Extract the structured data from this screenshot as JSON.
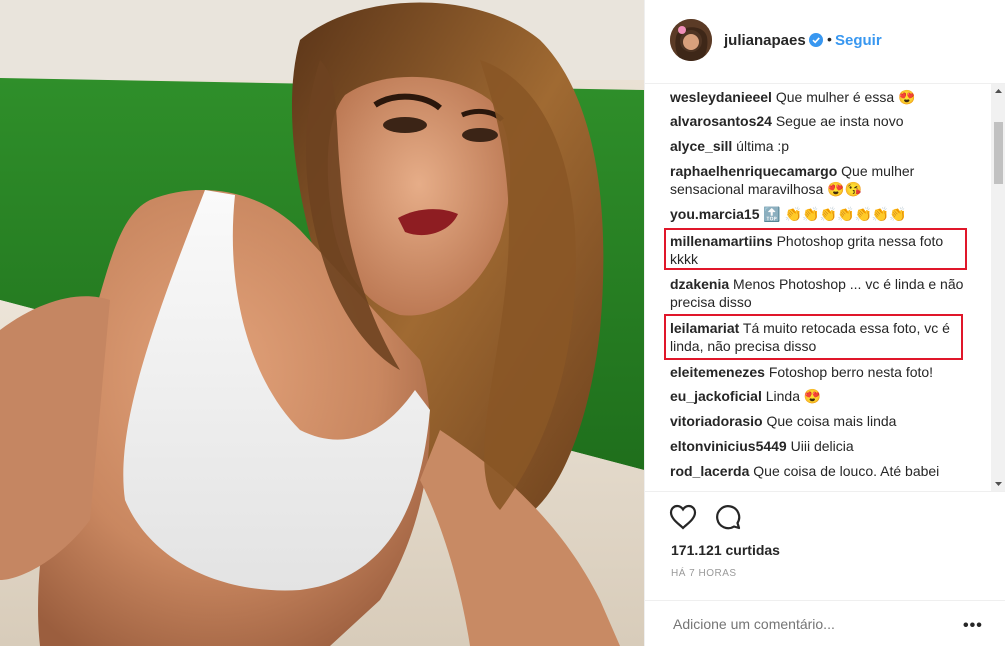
{
  "post": {
    "image_alt": "Woman in a white tank top posing on a floor with green grass behind"
  },
  "header": {
    "username": "julianapaes",
    "separator": "•",
    "follow_label": "Seguir"
  },
  "comments": [
    {
      "user": "wesleydanieeel",
      "text": "Que mulher é essa 😍"
    },
    {
      "user": "alvarosantos24",
      "text": "Segue ae insta novo"
    },
    {
      "user": "alyce_sill",
      "text": "última :p"
    },
    {
      "user": "raphaelhenriquecamargo",
      "text": "Que mulher sensacional maravilhosa 😍😘"
    },
    {
      "user": "you.marcia15",
      "text": "🔝 👏👏👏👏👏👏👏"
    },
    {
      "user": "millenamartiins",
      "text": "Photoshop grita nessa foto kkkk"
    },
    {
      "user": "dzakenia",
      "text": "Menos Photoshop ... vc é linda e não precisa disso"
    },
    {
      "user": "leilamariat",
      "text": "Tá muito retocada essa foto, vc é linda, não precisa disso"
    },
    {
      "user": "eleitemenezes",
      "text": "Fotoshop berro nesta foto!"
    },
    {
      "user": "eu_jackoficial",
      "text": "Linda 😍"
    },
    {
      "user": "vitoriadorasio",
      "text": "Que coisa mais linda"
    },
    {
      "user": "eltonvinicius5449",
      "text": "Uiii delicia"
    },
    {
      "user": "rod_lacerda",
      "text": "Que coisa de louco. Até babei"
    }
  ],
  "actions": {
    "likes": "171.121 curtidas",
    "time": "HÁ 7 HORAS",
    "add_comment_placeholder": "Adicione um comentário...",
    "more_label": "•••"
  },
  "colors": {
    "link_blue": "#3897f0",
    "highlight_red": "#e0172a",
    "text": "#262626",
    "muted": "#999999"
  }
}
